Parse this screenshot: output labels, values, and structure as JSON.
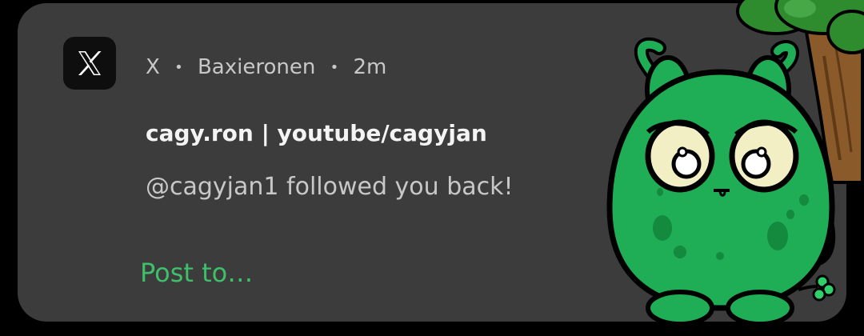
{
  "notification": {
    "app_name": "X",
    "separator": "•",
    "account": "Baxieronen",
    "time": "2m",
    "title": "cagy.ron | youtube/cagyjan",
    "message": "@cagyjan1 followed you back!",
    "action_label": "Post to…"
  },
  "icons": {
    "app": "x-logo-icon"
  },
  "colors": {
    "background": "#000000",
    "card": "#3c3c3c",
    "header_text": "#c8c8c8",
    "title_text": "#f4f4f4",
    "action": "#3fbf6a",
    "monster": "#1fae55"
  }
}
